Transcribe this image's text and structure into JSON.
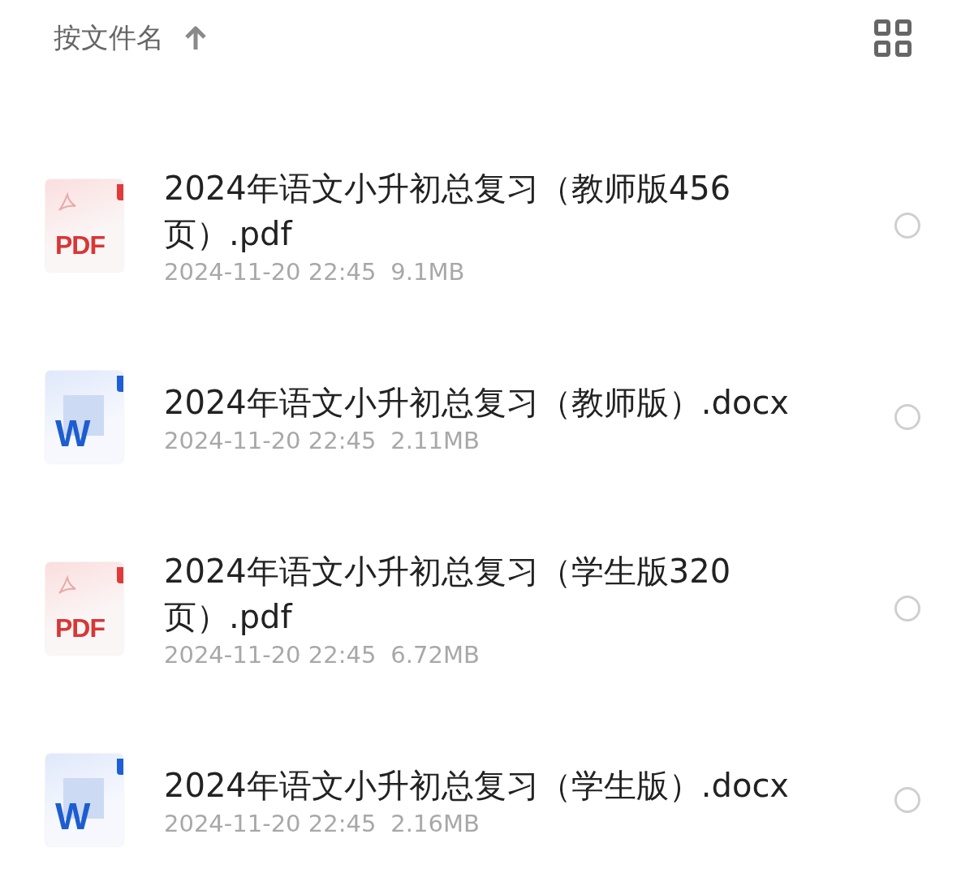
{
  "header": {
    "sort_label": "按文件名"
  },
  "files": [
    {
      "kind": "pdf",
      "badge": "PDF",
      "name": "2024年语文小升初总复习（教师版456页）.pdf",
      "date": "2024-11-20 22:45",
      "size": "9.1MB",
      "selected": false
    },
    {
      "kind": "word",
      "badge": "W",
      "name": "2024年语文小升初总复习（教师版）.docx",
      "date": "2024-11-20 22:45",
      "size": "2.11MB",
      "selected": false
    },
    {
      "kind": "pdf",
      "badge": "PDF",
      "name": "2024年语文小升初总复习（学生版320页）.pdf",
      "date": "2024-11-20 22:45",
      "size": "6.72MB",
      "selected": false
    },
    {
      "kind": "word",
      "badge": "W",
      "name": "2024年语文小升初总复习（学生版）.docx",
      "date": "2024-11-20 22:45",
      "size": "2.16MB",
      "selected": false
    }
  ]
}
